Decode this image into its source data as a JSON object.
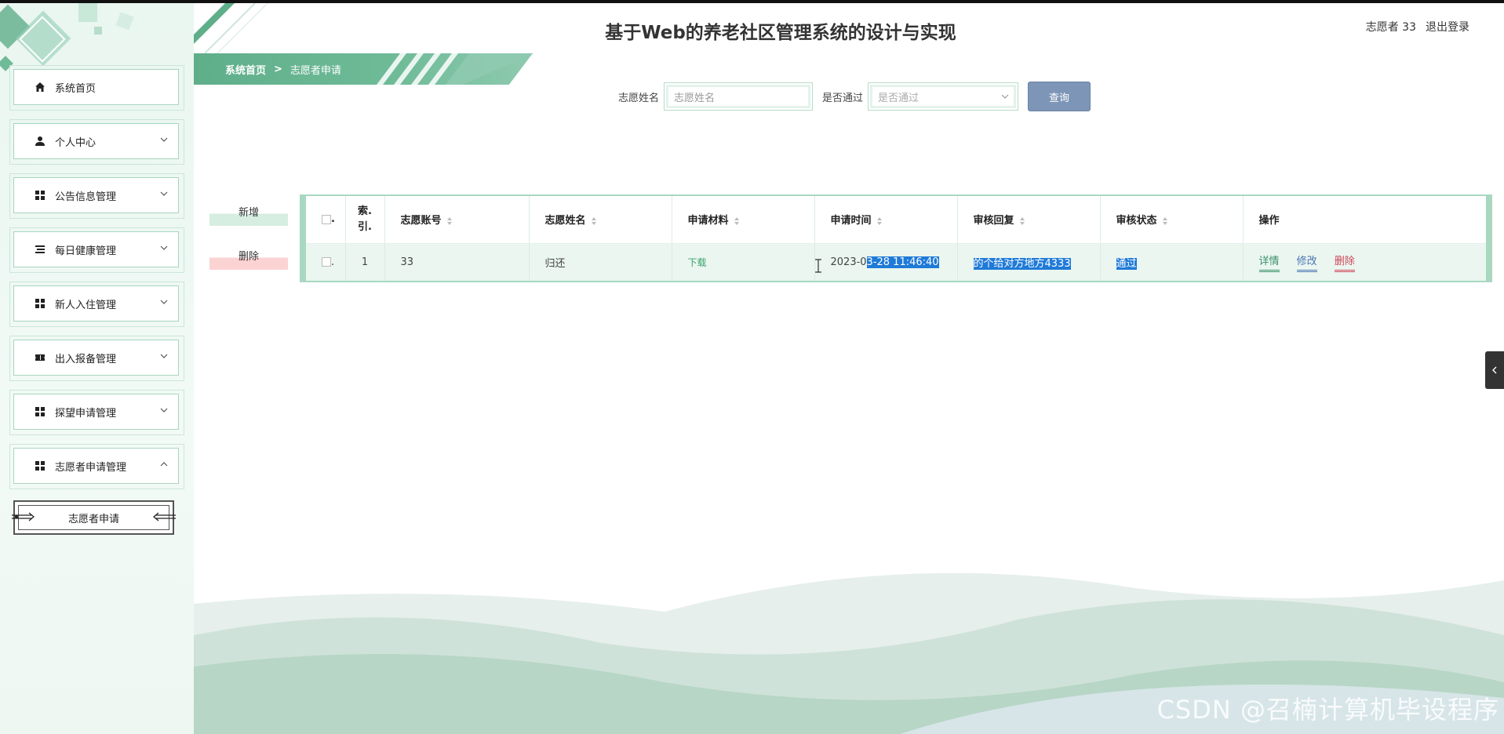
{
  "app": {
    "title": "基于Web的养老社区管理系统的设计与实现",
    "user_label": "志愿者 33",
    "logout_label": "退出登录"
  },
  "breadcrumb": {
    "home": "系统首页",
    "separator": ">",
    "current": "志愿者申请"
  },
  "sidebar": {
    "items": [
      {
        "label": "系统首页",
        "icon": "home-icon"
      },
      {
        "label": "个人中心",
        "icon": "user-icon"
      },
      {
        "label": "公告信息管理",
        "icon": "grid-icon"
      },
      {
        "label": "每日健康管理",
        "icon": "list-icon"
      },
      {
        "label": "新人入住管理",
        "icon": "grid-icon"
      },
      {
        "label": "出入报备管理",
        "icon": "ticket-icon"
      },
      {
        "label": "探望申请管理",
        "icon": "grid-icon"
      },
      {
        "label": "志愿者申请管理",
        "icon": "grid-icon"
      }
    ],
    "submenu": {
      "label": "志愿者申请"
    }
  },
  "search": {
    "name_label": "志愿姓名",
    "name_placeholder": "志愿姓名",
    "pass_label": "是否通过",
    "pass_placeholder": "是否通过",
    "query_label": "查询"
  },
  "actions": {
    "add_label": "新增",
    "delete_label": "删除"
  },
  "table": {
    "headers": {
      "check": ".",
      "index": "索.\n引.",
      "account": "志愿账号",
      "name": "志愿姓名",
      "material": "申请材料",
      "time": "申请时间",
      "reply": "审核回复",
      "status": "审核状态",
      "ops": "操作"
    },
    "rows": [
      {
        "check": ".",
        "index": "1",
        "account": "33",
        "name": "归还",
        "material": "下载",
        "time_prefix": "2023-0",
        "time_hl": "3-28 11:46:40",
        "reply": "的个给对方地方4333",
        "status": "通过",
        "op_detail": "详情",
        "op_edit": "修改",
        "op_delete": "删除"
      }
    ]
  },
  "watermark": "CSDN @召楠计算机毕设程序",
  "colors": {
    "accent": "#6fbb98",
    "query_button": "#7d95b6",
    "selection": "#1f7ad8"
  }
}
